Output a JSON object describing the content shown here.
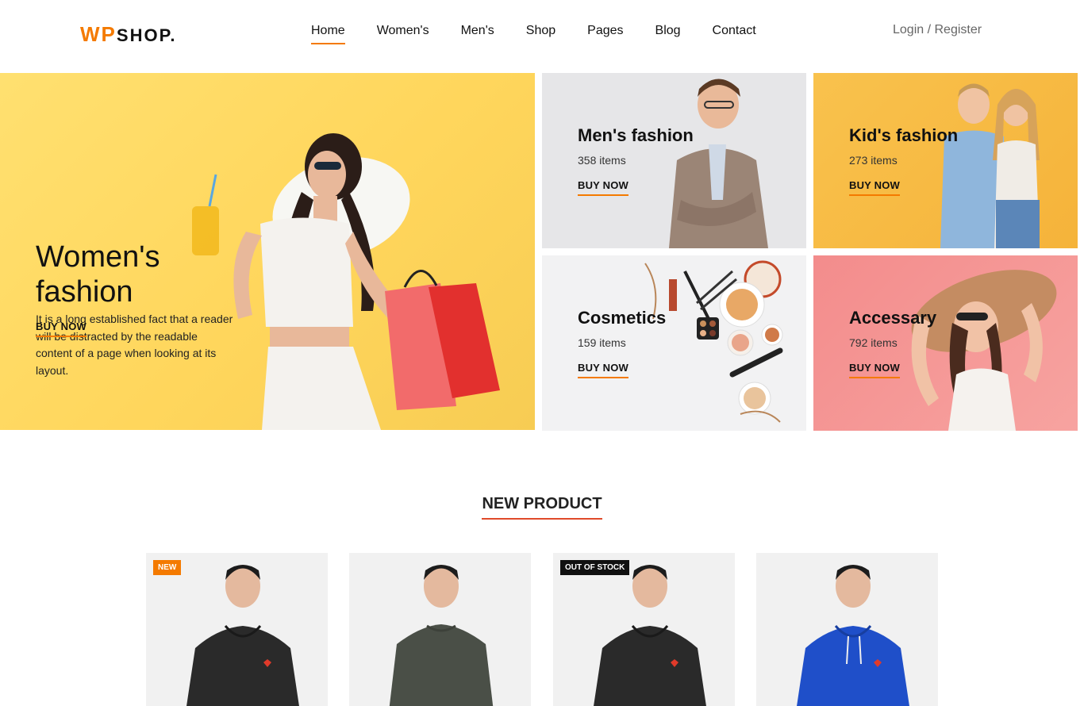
{
  "header": {
    "logo_wp": "WP",
    "logo_shop": "SHOP.",
    "nav": [
      "Home",
      "Women's",
      "Men's",
      "Shop",
      "Pages",
      "Blog",
      "Contact"
    ],
    "active_nav": "Home",
    "login": "Login",
    "separator": " / ",
    "register": "Register"
  },
  "hero": {
    "title_line1": "Women's",
    "title_line2": "fashion",
    "description": "It is a long established fact that a reader will be distracted by the readable content of a page when looking at its layout.",
    "cta": "BUY NOW"
  },
  "tiles": [
    {
      "title": "Men's fashion",
      "count": "358 items",
      "cta": "BUY NOW"
    },
    {
      "title": "Kid's fashion",
      "count": "273 items",
      "cta": "BUY NOW"
    },
    {
      "title": "Cosmetics",
      "count": "159 items",
      "cta": "BUY NOW"
    },
    {
      "title": "Accessary",
      "count": "792 items",
      "cta": "BUY NOW"
    }
  ],
  "new_product": {
    "title": "NEW PRODUCT",
    "products": [
      {
        "badge": "NEW",
        "shirt_color": "#2a2a2a"
      },
      {
        "badge": "",
        "shirt_color": "#4a4f47"
      },
      {
        "badge": "OUT OF STOCK",
        "shirt_color": "#2a2a2a"
      },
      {
        "badge": "",
        "shirt_color": "#1f4fc9"
      }
    ]
  },
  "colors": {
    "accent": "#f47a00",
    "section_underline": "#e04a2a",
    "hero_bg": "#ffd65c"
  }
}
